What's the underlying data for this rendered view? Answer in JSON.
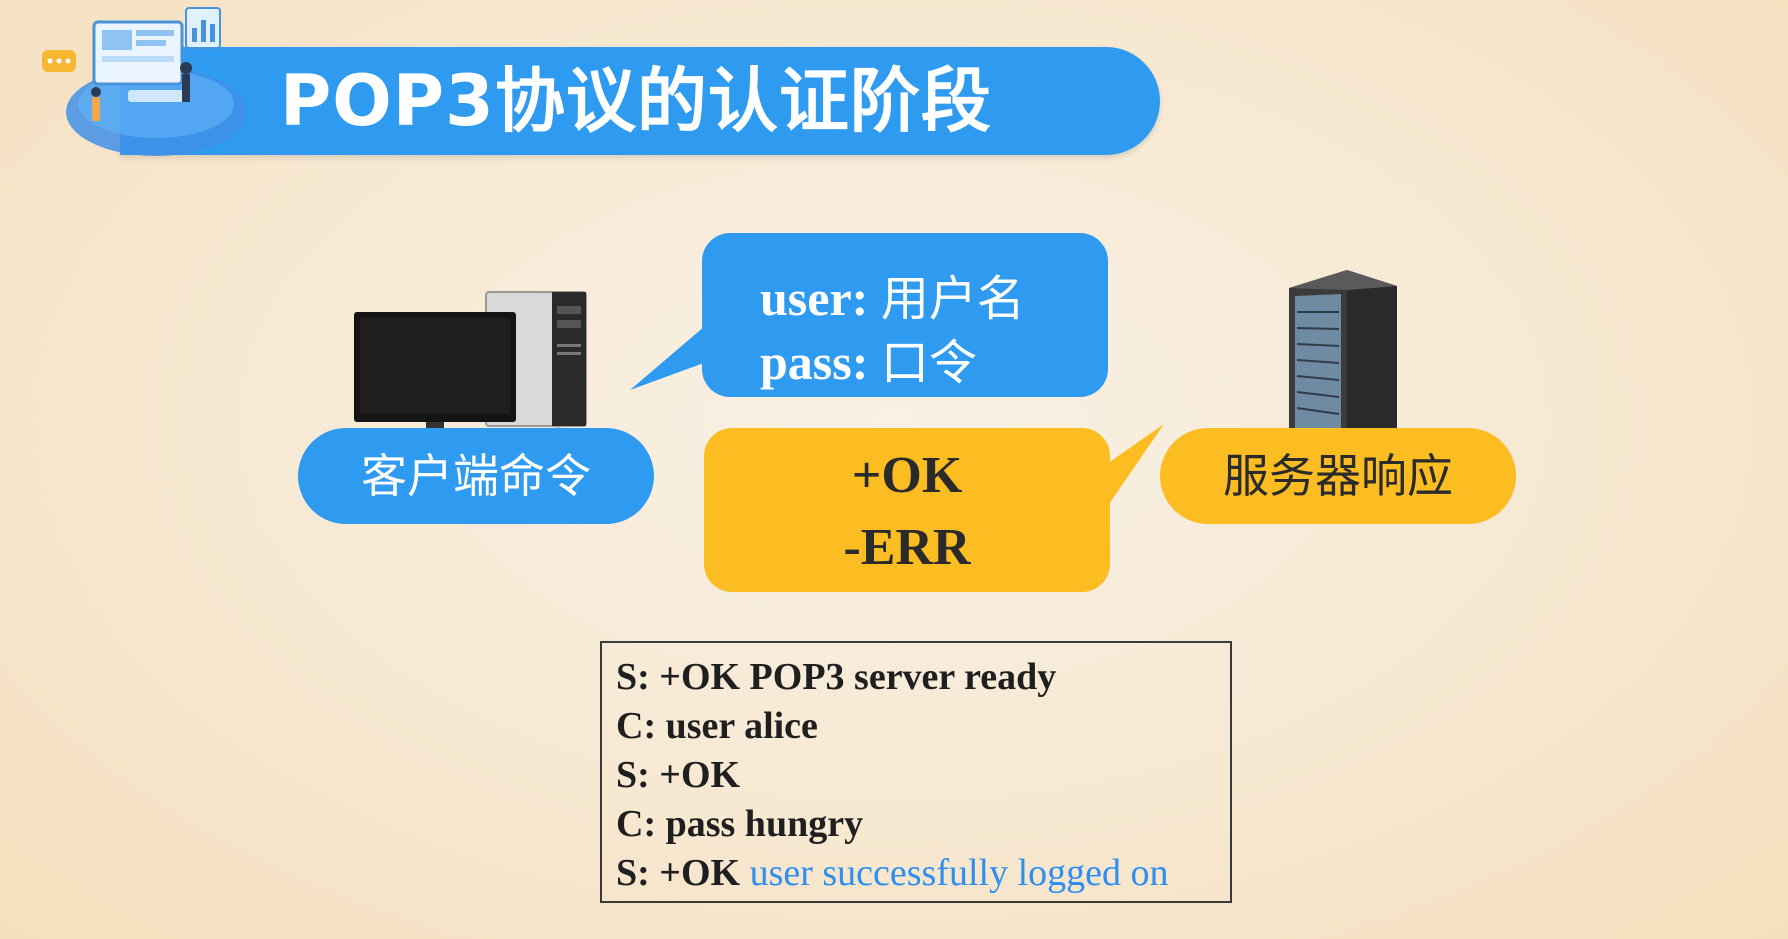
{
  "slide": {
    "title": "POP3协议的认证阶段"
  },
  "client": {
    "label": "客户端命令",
    "commands": [
      {
        "key": "user:",
        "value": "用户名"
      },
      {
        "key": "pass:",
        "value": "口令"
      }
    ]
  },
  "server": {
    "label": "服务器响应",
    "responses": [
      "+OK",
      "-ERR"
    ]
  },
  "session_log": [
    {
      "text": "S: +OK POP3 server ready",
      "note": ""
    },
    {
      "text": "C: user alice",
      "note": ""
    },
    {
      "text": "S: +OK",
      "note": ""
    },
    {
      "text": "C: pass hungry",
      "note": ""
    },
    {
      "text": "S: +OK ",
      "note": "user successfully logged on"
    }
  ],
  "colors": {
    "blue": "#2f9bf0",
    "yellow": "#fbbd22",
    "note_blue": "#2e8ff0"
  },
  "icons": [
    "desktop-computer-icon",
    "server-rack-icon",
    "office-illustration"
  ]
}
